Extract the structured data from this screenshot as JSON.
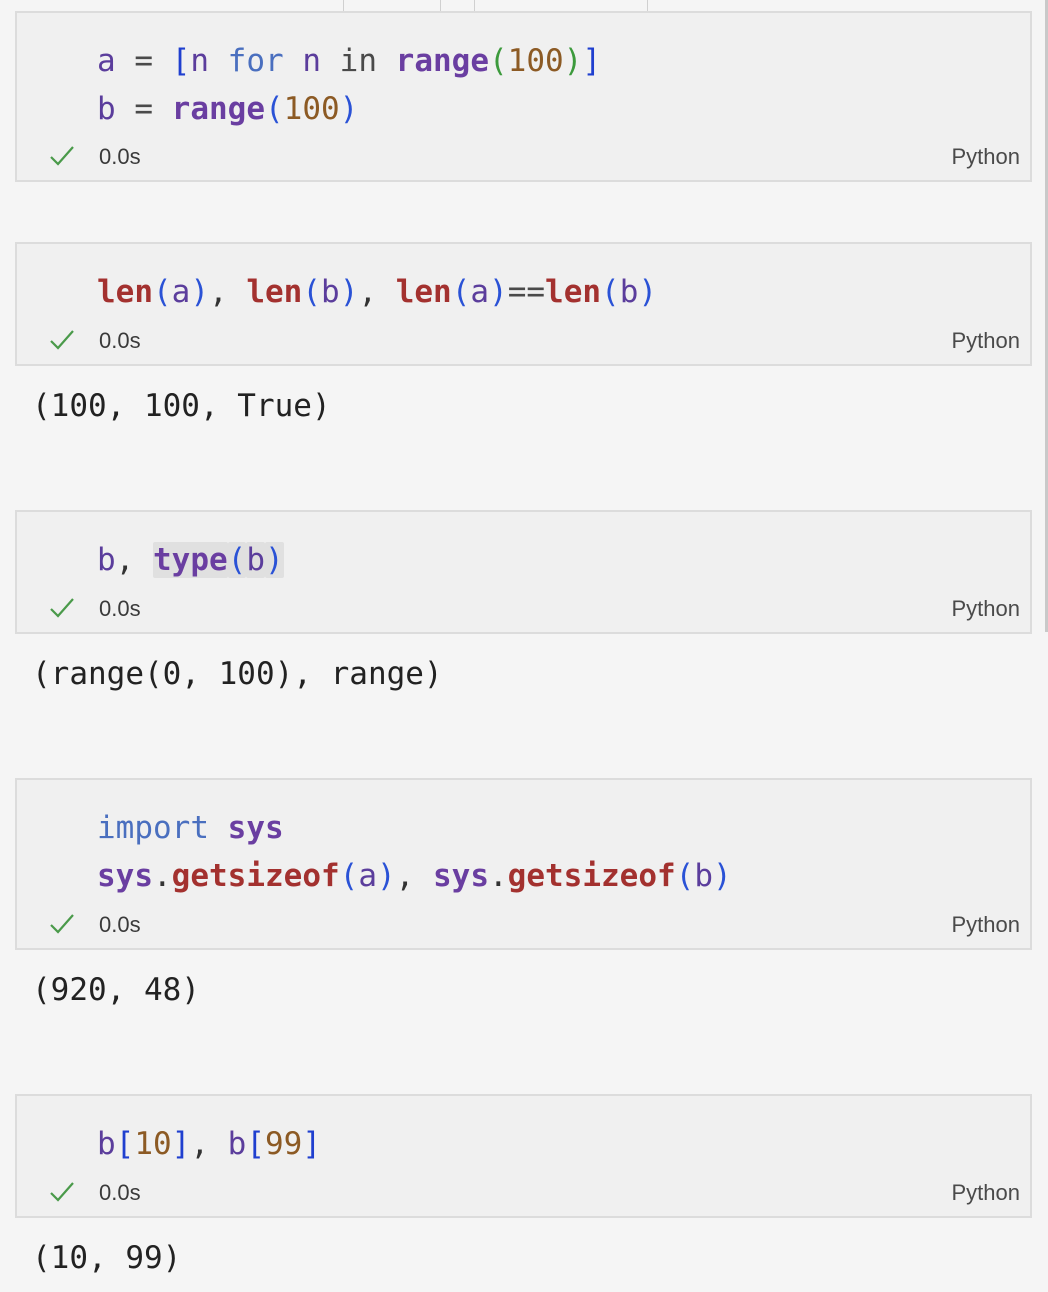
{
  "cells": [
    {
      "code_lines": [
        [
          {
            "t": "a",
            "c": "t-var"
          },
          {
            "t": " = ",
            "c": "t-op"
          },
          {
            "t": "[",
            "c": "t-bracket"
          },
          {
            "t": "n",
            "c": "t-var"
          },
          {
            "t": " for ",
            "c": "t-kw"
          },
          {
            "t": "n",
            "c": "t-var"
          },
          {
            "t": " in ",
            "c": "t-op"
          },
          {
            "t": "range",
            "c": "t-fn"
          },
          {
            "t": "(",
            "c": "t-paren-green"
          },
          {
            "t": "100",
            "c": "t-num"
          },
          {
            "t": ")",
            "c": "t-paren-green"
          },
          {
            "t": "]",
            "c": "t-bracket"
          }
        ],
        [
          {
            "t": "b",
            "c": "t-var"
          },
          {
            "t": " = ",
            "c": "t-op"
          },
          {
            "t": "range",
            "c": "t-fn"
          },
          {
            "t": "(",
            "c": "t-paren"
          },
          {
            "t": "100",
            "c": "t-num"
          },
          {
            "t": ")",
            "c": "t-paren"
          }
        ]
      ],
      "status": {
        "time": "0.0s",
        "language": "Python"
      },
      "output": ""
    },
    {
      "code_lines": [
        [
          {
            "t": "len",
            "c": "t-fnred"
          },
          {
            "t": "(",
            "c": "t-paren"
          },
          {
            "t": "a",
            "c": "t-var"
          },
          {
            "t": ")",
            "c": "t-paren"
          },
          {
            "t": ", ",
            "c": "t-punc"
          },
          {
            "t": "len",
            "c": "t-fnred"
          },
          {
            "t": "(",
            "c": "t-paren"
          },
          {
            "t": "b",
            "c": "t-var"
          },
          {
            "t": ")",
            "c": "t-paren"
          },
          {
            "t": ", ",
            "c": "t-punc"
          },
          {
            "t": "len",
            "c": "t-fnred"
          },
          {
            "t": "(",
            "c": "t-paren"
          },
          {
            "t": "a",
            "c": "t-var"
          },
          {
            "t": ")",
            "c": "t-paren"
          },
          {
            "t": "==",
            "c": "t-op"
          },
          {
            "t": "len",
            "c": "t-fnred"
          },
          {
            "t": "(",
            "c": "t-paren"
          },
          {
            "t": "b",
            "c": "t-var"
          },
          {
            "t": ")",
            "c": "t-paren"
          }
        ]
      ],
      "status": {
        "time": "0.0s",
        "language": "Python"
      },
      "output": "(100, 100, True)"
    },
    {
      "code_lines": [
        [
          {
            "t": "b",
            "c": "t-var"
          },
          {
            "t": ", ",
            "c": "t-punc"
          },
          {
            "t": "type",
            "c": "t-fn hl"
          },
          {
            "t": "(",
            "c": "t-paren hl"
          },
          {
            "t": "b",
            "c": "t-var hl"
          },
          {
            "t": ")",
            "c": "t-paren hl"
          }
        ]
      ],
      "status": {
        "time": "0.0s",
        "language": "Python"
      },
      "output": "(range(0, 100), range)"
    },
    {
      "code_lines": [
        [
          {
            "t": "import",
            "c": "t-kw"
          },
          {
            "t": " ",
            "c": "t-op"
          },
          {
            "t": "sys",
            "c": "t-mod"
          }
        ],
        [
          {
            "t": "sys",
            "c": "t-mod"
          },
          {
            "t": ".",
            "c": "t-punc"
          },
          {
            "t": "getsizeof",
            "c": "t-fnred"
          },
          {
            "t": "(",
            "c": "t-paren"
          },
          {
            "t": "a",
            "c": "t-var"
          },
          {
            "t": ")",
            "c": "t-paren"
          },
          {
            "t": ", ",
            "c": "t-punc"
          },
          {
            "t": "sys",
            "c": "t-mod"
          },
          {
            "t": ".",
            "c": "t-punc"
          },
          {
            "t": "getsizeof",
            "c": "t-fnred"
          },
          {
            "t": "(",
            "c": "t-paren"
          },
          {
            "t": "b",
            "c": "t-var"
          },
          {
            "t": ")",
            "c": "t-paren"
          }
        ]
      ],
      "status": {
        "time": "0.0s",
        "language": "Python"
      },
      "output": "(920, 48)"
    },
    {
      "code_lines": [
        [
          {
            "t": "b",
            "c": "t-var"
          },
          {
            "t": "[",
            "c": "t-bracket"
          },
          {
            "t": "10",
            "c": "t-num"
          },
          {
            "t": "]",
            "c": "t-bracket"
          },
          {
            "t": ", ",
            "c": "t-punc"
          },
          {
            "t": "b",
            "c": "t-var"
          },
          {
            "t": "[",
            "c": "t-bracket"
          },
          {
            "t": "99",
            "c": "t-num"
          },
          {
            "t": "]",
            "c": "t-bracket"
          }
        ]
      ],
      "status": {
        "time": "0.0s",
        "language": "Python"
      },
      "output": "(10, 99)"
    }
  ],
  "colors": {
    "check": "#4a9a4a",
    "cell_bg": "#f0f0f0",
    "page_bg": "#f5f5f5"
  },
  "icons": {
    "status_icon": "checkmark-icon"
  }
}
